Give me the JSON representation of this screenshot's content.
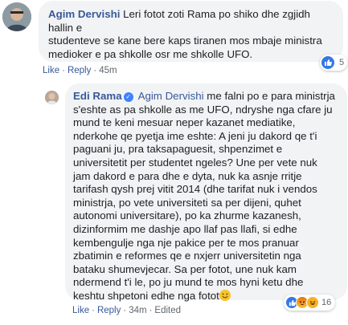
{
  "comment": {
    "author": "Agim Dervishi",
    "lines": [
      "Leri fotot zoti Rama po shiko dhe zgjidh hallin e",
      "studenteve se kane bere kaps tiranen mos mbaje ministra",
      "medioker e pa shkolle osr me shkolle UFO."
    ],
    "actions": {
      "like": "Like",
      "reply": "Reply",
      "time": "45m"
    },
    "reaction_count": "5"
  },
  "reply": {
    "author": "Edi Rama",
    "mention": "Agim Dervishi",
    "first_line_rest": "me falni po e para ministrja",
    "lines": [
      "s'eshte as pa shkolle as me UFO, ndryshe nga cfare ju",
      "mund te keni mesuar neper kazanet mediatike,",
      "nderkohe qe pyetja ime eshte: A jeni ju dakord qe t'i",
      "paguani ju, pra taksapaguesit, shpenzimet e",
      "universitetit per studentet ngeles? Une per vete nuk",
      "jam dakord e para dhe e dyta, nuk ka asnje rritje",
      "tarifash qysh prej vitit 2014 (dhe tarifat nuk i vendos",
      "ministrja, po vete universiteti sa per dijeni, quhet",
      "autonomi universitare), po ka zhurme kazanesh,",
      "dizinformim me dashje apo llaf pas llafi, si edhe",
      "kembengulje nga nje pakice per te mos pranuar",
      "zbatimin e reformes qe e nxjerr universitetin nga",
      "bataku shumevjecar. Sa per fotot, une nuk kam",
      "ndermend t'i le, po ju mund te mos hyni ketu dhe"
    ],
    "last_line": "keshtu shpetoni edhe nga fotot",
    "actions": {
      "like": "Like",
      "reply": "Reply",
      "time": "34m",
      "edited": "Edited"
    },
    "reaction_count": "16"
  },
  "icons": {
    "verified": "verified-badge-icon",
    "like": "thumbs-up-icon",
    "angry": "angry-face-icon",
    "haha": "laughing-face-icon",
    "emoji": "smiling-face-emoji"
  },
  "colors": {
    "link": "#385898",
    "bubble": "#f2f3f5",
    "text": "#1c1e21",
    "meta": "#606770",
    "like_blue": "#3578e5"
  }
}
